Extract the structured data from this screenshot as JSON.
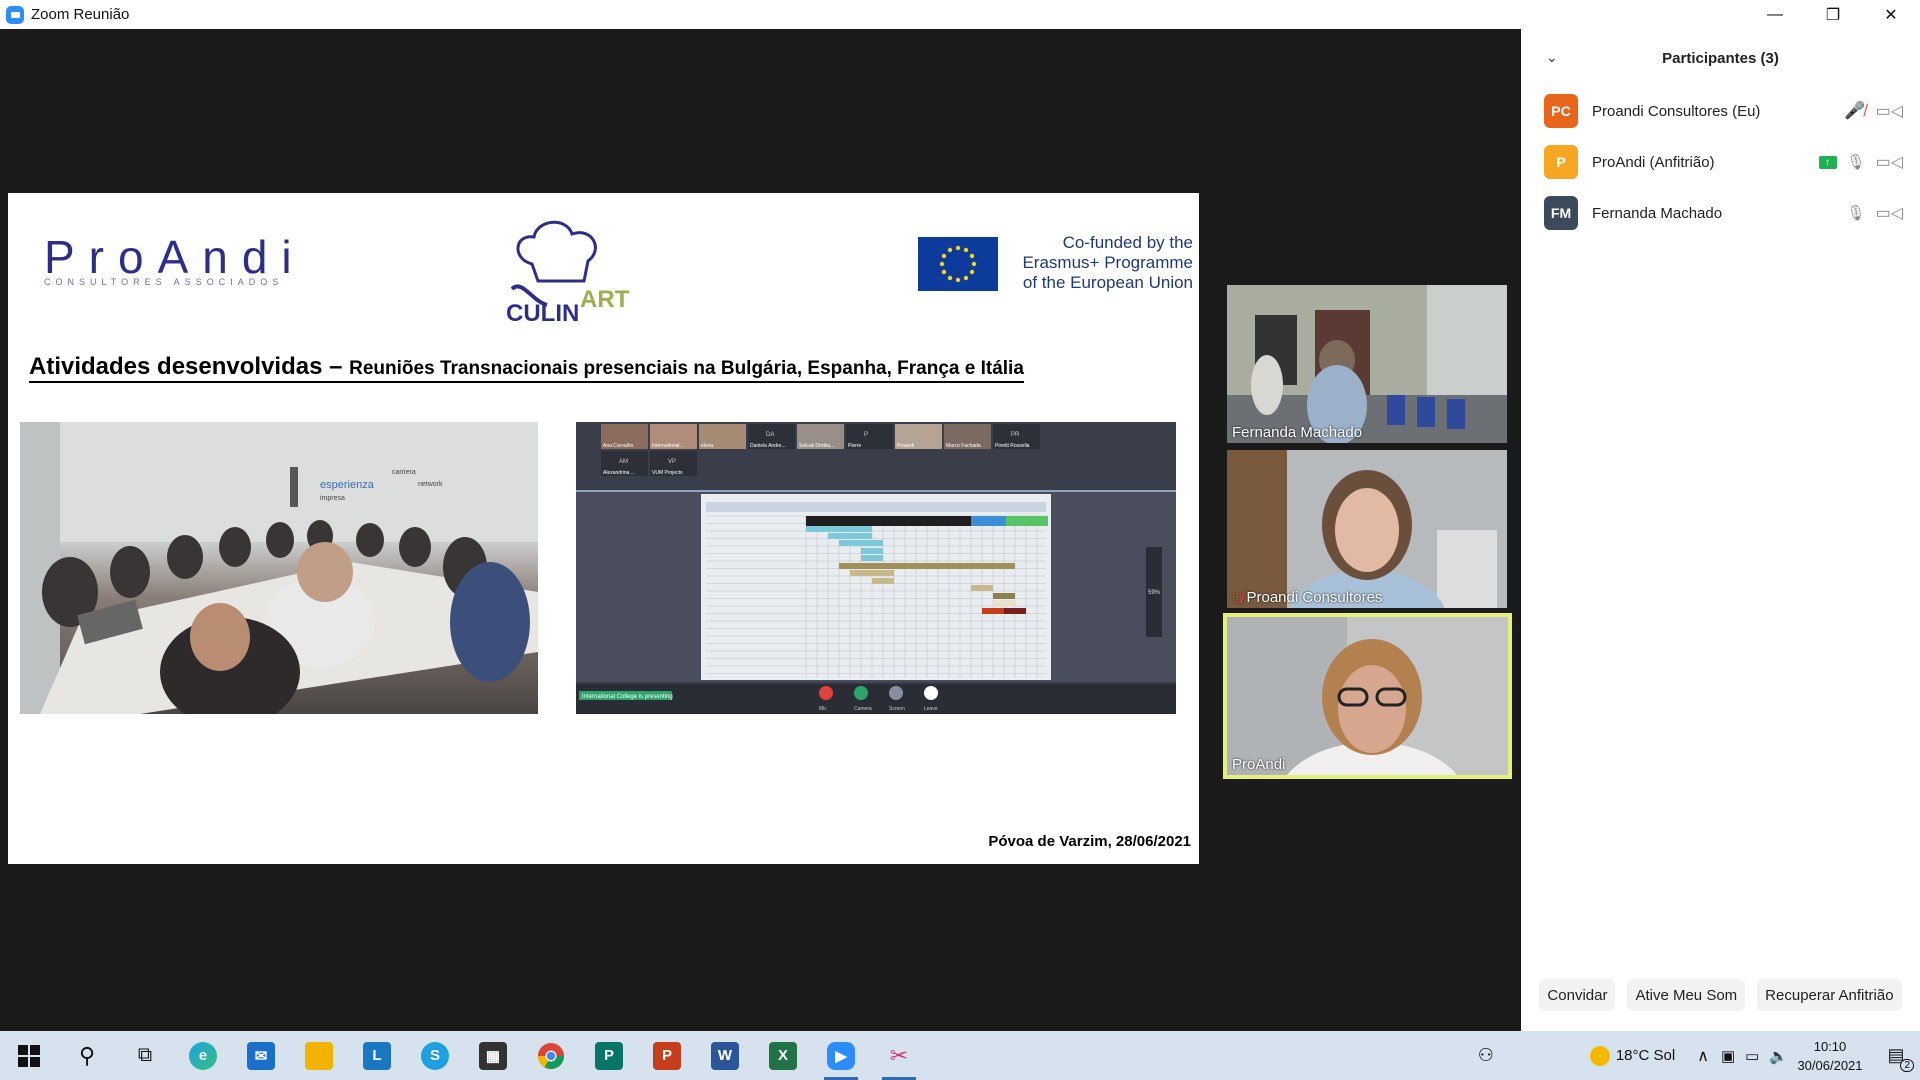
{
  "window": {
    "title": "Zoom Reunião",
    "controls": {
      "minimize": "—",
      "restore": "❐",
      "close": "✕"
    }
  },
  "slide": {
    "logo_word": "ProAndi",
    "logo_sub": "CONSULTORES ASSOCIADOS",
    "eu_text": [
      "Co-funded by the",
      "Erasmus+ Programme",
      "of the European Union"
    ],
    "heading_main": "Atividades desenvolvidas – ",
    "heading_sub": "Reuniões Transnacionais presenciais na Bulgária, Espanha, França e Itália",
    "footer": "Póvoa de Varzim, 28/06/2021",
    "photo1_wall_words": [
      "esperienza",
      "impresa",
      "network",
      "carriera"
    ],
    "photo2_tiles": [
      "Ana Carvalho",
      "International ...",
      "elena",
      "Daniela Andre...",
      "Selcuk Dortku...",
      "Pierre",
      "Proandi",
      "Marco Fachada",
      "Pinetti Rossella",
      "Alexandrina ...",
      "VUM Projects"
    ],
    "photo2_tile_initials": [
      "DA",
      "P",
      "PR",
      "AM",
      "VP"
    ],
    "photo2_presenting": "International College is presenting",
    "photo2_controls": [
      "Mic",
      "Camera",
      "Screen",
      "Leave"
    ],
    "photo2_zoom": "59%"
  },
  "videos": [
    {
      "name": "Fernanda Machado",
      "muted": false
    },
    {
      "name": "Proandi Consultores",
      "muted": true
    },
    {
      "name": "ProAndi",
      "muted": false
    }
  ],
  "participants_panel": {
    "title": "Participantes (3)",
    "participants": [
      {
        "initials": "PC",
        "name": "Proandi Consultores (Eu)",
        "color": "#e8661c"
      },
      {
        "initials": "P",
        "name": "ProAndi (Anfitrião)",
        "color": "#f5a623"
      },
      {
        "initials": "FM",
        "name": "Fernanda Machado",
        "color": "#3c4a5c"
      }
    ],
    "buttons": {
      "invite": "Convidar",
      "unmute": "Ative Meu Som",
      "reclaim": "Recuperar Anfitrião"
    }
  },
  "taskbar": {
    "weather": "18°C  Sol",
    "time": "10:10",
    "date": "30/06/2021",
    "notifications": "2",
    "apps": [
      "start",
      "search",
      "task-view",
      "edge",
      "mail",
      "explorer",
      "l-app",
      "skype",
      "store",
      "chrome",
      "publisher",
      "powerpoint",
      "word",
      "excel",
      "zoom",
      "snip"
    ]
  },
  "colors": {
    "accent": "#2d8cff",
    "active_speaker": "#e6ef7a",
    "taskbar": "#d6e3ee"
  }
}
